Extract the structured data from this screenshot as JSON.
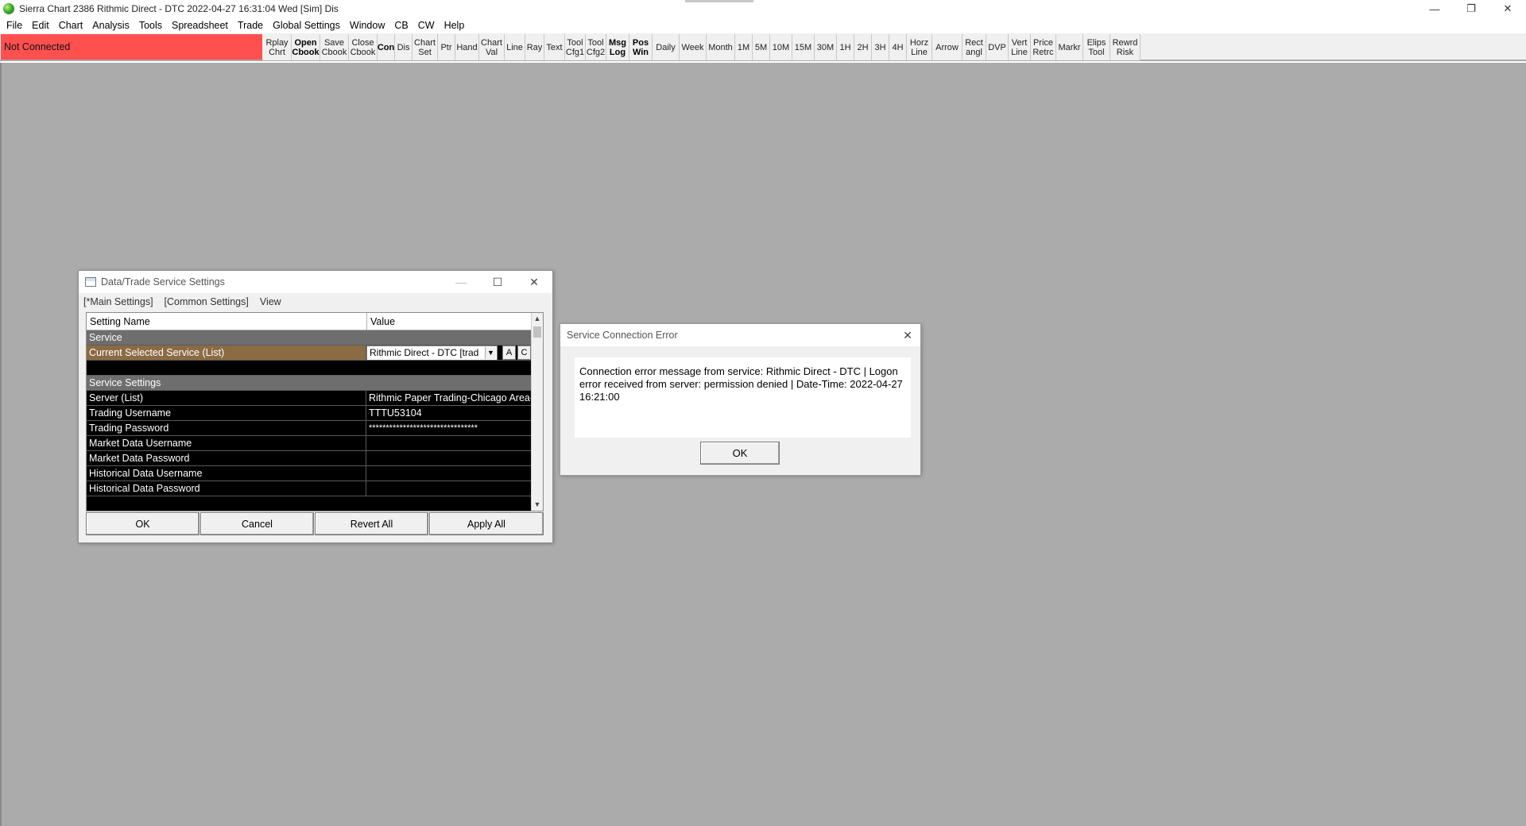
{
  "window": {
    "title": "Sierra Chart 2386 Rithmic Direct - DTC 2022-04-27  16:31:04 Wed [Sim]  Dis",
    "controls": {
      "minimize": "—",
      "restore": "❐",
      "close": "✕"
    }
  },
  "menu": [
    "File",
    "Edit",
    "Chart",
    "Analysis",
    "Tools",
    "Spreadsheet",
    "Trade",
    "Global Settings",
    "Window",
    "CB",
    "CW",
    "Help"
  ],
  "toolbar": {
    "status": "Not Connected",
    "status_color": "#ff5050",
    "buttons": [
      {
        "l1": "Rplay",
        "l2": "Chrt",
        "bold": false
      },
      {
        "l1": "Open",
        "l2": "Cbook",
        "bold": true
      },
      {
        "l1": "Save",
        "l2": "Cbook",
        "bold": false
      },
      {
        "l1": "Close",
        "l2": "Cbook",
        "bold": false
      },
      {
        "l1": "Con",
        "l2": "",
        "bold": true
      },
      {
        "l1": "Dis",
        "l2": "",
        "bold": false
      },
      {
        "l1": "Chart",
        "l2": "Set",
        "bold": false
      },
      {
        "l1": "Ptr",
        "l2": "",
        "bold": false
      },
      {
        "l1": "Hand",
        "l2": "",
        "bold": false
      },
      {
        "l1": "Chart",
        "l2": "Val",
        "bold": false
      },
      {
        "l1": "Line",
        "l2": "",
        "bold": false
      },
      {
        "l1": "Ray",
        "l2": "",
        "bold": false
      },
      {
        "l1": "Text",
        "l2": "",
        "bold": false
      },
      {
        "l1": "Tool",
        "l2": "Cfg1",
        "bold": false
      },
      {
        "l1": "Tool",
        "l2": "Cfg2",
        "bold": false
      },
      {
        "l1": "Msg",
        "l2": "Log",
        "bold": true
      },
      {
        "l1": "Pos",
        "l2": "Win",
        "bold": true
      },
      {
        "l1": "Daily",
        "l2": "",
        "bold": false
      },
      {
        "l1": "Week",
        "l2": "",
        "bold": false
      },
      {
        "l1": "Month",
        "l2": "",
        "bold": false
      },
      {
        "l1": "1M",
        "l2": "",
        "bold": false
      },
      {
        "l1": "5M",
        "l2": "",
        "bold": false
      },
      {
        "l1": "10M",
        "l2": "",
        "bold": false
      },
      {
        "l1": "15M",
        "l2": "",
        "bold": false
      },
      {
        "l1": "30M",
        "l2": "",
        "bold": false
      },
      {
        "l1": "1H",
        "l2": "",
        "bold": false
      },
      {
        "l1": "2H",
        "l2": "",
        "bold": false
      },
      {
        "l1": "3H",
        "l2": "",
        "bold": false
      },
      {
        "l1": "4H",
        "l2": "",
        "bold": false
      },
      {
        "l1": "Horz",
        "l2": "Line",
        "bold": false
      },
      {
        "l1": "Arrow",
        "l2": "",
        "bold": false
      },
      {
        "l1": "Rect",
        "l2": "angl",
        "bold": false
      },
      {
        "l1": "DVP",
        "l2": "",
        "bold": false
      },
      {
        "l1": "Vert",
        "l2": "Line",
        "bold": false
      },
      {
        "l1": "Price",
        "l2": "Retrc",
        "bold": false
      },
      {
        "l1": "Markr",
        "l2": "",
        "bold": false
      },
      {
        "l1": "Elips",
        "l2": "Tool",
        "bold": false
      },
      {
        "l1": "Rewrd",
        "l2": "Risk",
        "bold": false
      }
    ]
  },
  "settings_dialog": {
    "title": "Data/Trade Service Settings",
    "controls": {
      "minimize": "—",
      "maximize": "☐",
      "close": "✕"
    },
    "tabs": [
      "[*Main Settings]",
      "[Common Settings]",
      "View"
    ],
    "columns": {
      "name": "Setting Name",
      "value": "Value"
    },
    "section_service": "Service",
    "selected_row": {
      "name": "Current Selected Service (List)",
      "value": "Rithmic Direct - DTC   [trad",
      "btn_a": "A",
      "btn_c": "C"
    },
    "section_service_settings": "Service Settings",
    "rows": [
      {
        "name": "Server (List)",
        "value": "Rithmic Paper Trading-Chicago Area-A"
      },
      {
        "name": "Trading Username",
        "value": "TTTU53104"
      },
      {
        "name": "Trading Password",
        "value": "********************************"
      },
      {
        "name": "Market Data Username",
        "value": ""
      },
      {
        "name": "Market Data Password",
        "value": ""
      },
      {
        "name": "Historical Data Username",
        "value": ""
      },
      {
        "name": "Historical Data Password",
        "value": ""
      }
    ],
    "buttons": {
      "ok": "OK",
      "cancel": "Cancel",
      "revert": "Revert All",
      "apply": "Apply All"
    },
    "scroll": {
      "up": "▲",
      "down": "▼"
    }
  },
  "error_dialog": {
    "title": "Service Connection Error",
    "close": "✕",
    "message": "Connection error message from service: Rithmic Direct - DTC | Logon error received from server: permission denied | Date-Time: 2022-04-27 16:21:00",
    "ok": "OK"
  }
}
